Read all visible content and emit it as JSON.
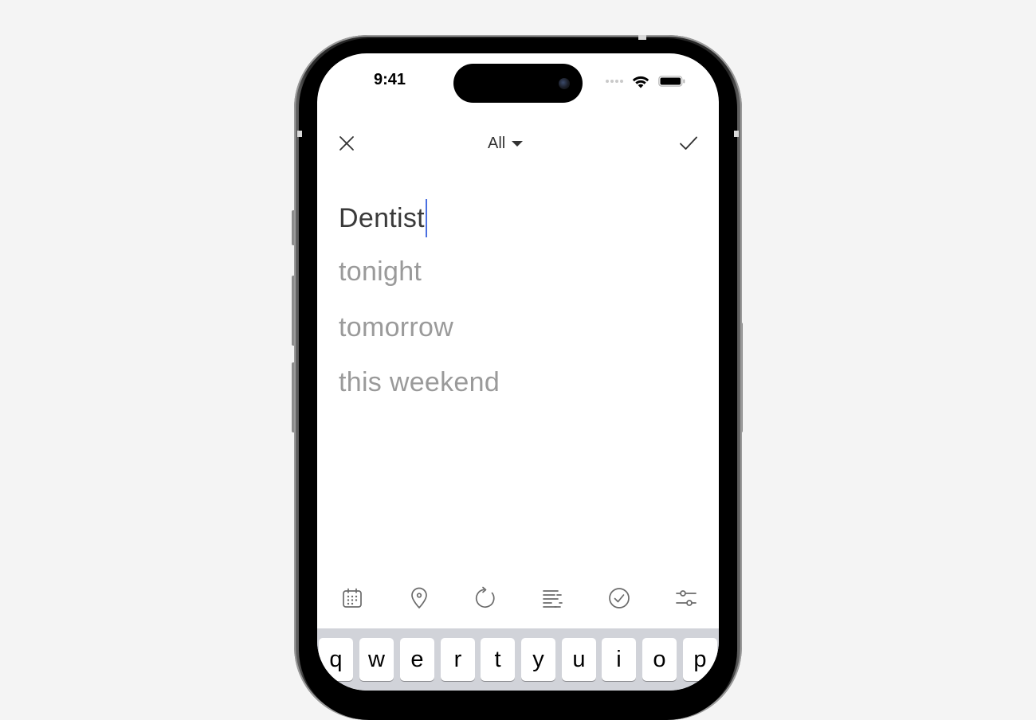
{
  "status_bar": {
    "time": "9:41"
  },
  "nav": {
    "close_icon": "close-icon",
    "filter_label": "All",
    "filter_icon": "caret-down-icon",
    "confirm_icon": "checkmark-icon"
  },
  "task_input": {
    "value": "Dentist"
  },
  "suggestions": [
    "tonight",
    "tomorrow",
    "this weekend"
  ],
  "toolbar": {
    "icons": [
      "calendar-icon",
      "location-pin-icon",
      "repeat-icon",
      "notes-icon",
      "checklist-icon",
      "settings-sliders-icon"
    ]
  },
  "keyboard": {
    "row1": [
      "q",
      "w",
      "e",
      "r",
      "t",
      "y",
      "u",
      "i",
      "o",
      "p"
    ]
  },
  "colors": {
    "accent_cursor": "#4a6fe0",
    "suggestion_text": "#9a9a9a",
    "input_text": "#3a3a3a",
    "keyboard_bg": "#d1d3d9"
  }
}
